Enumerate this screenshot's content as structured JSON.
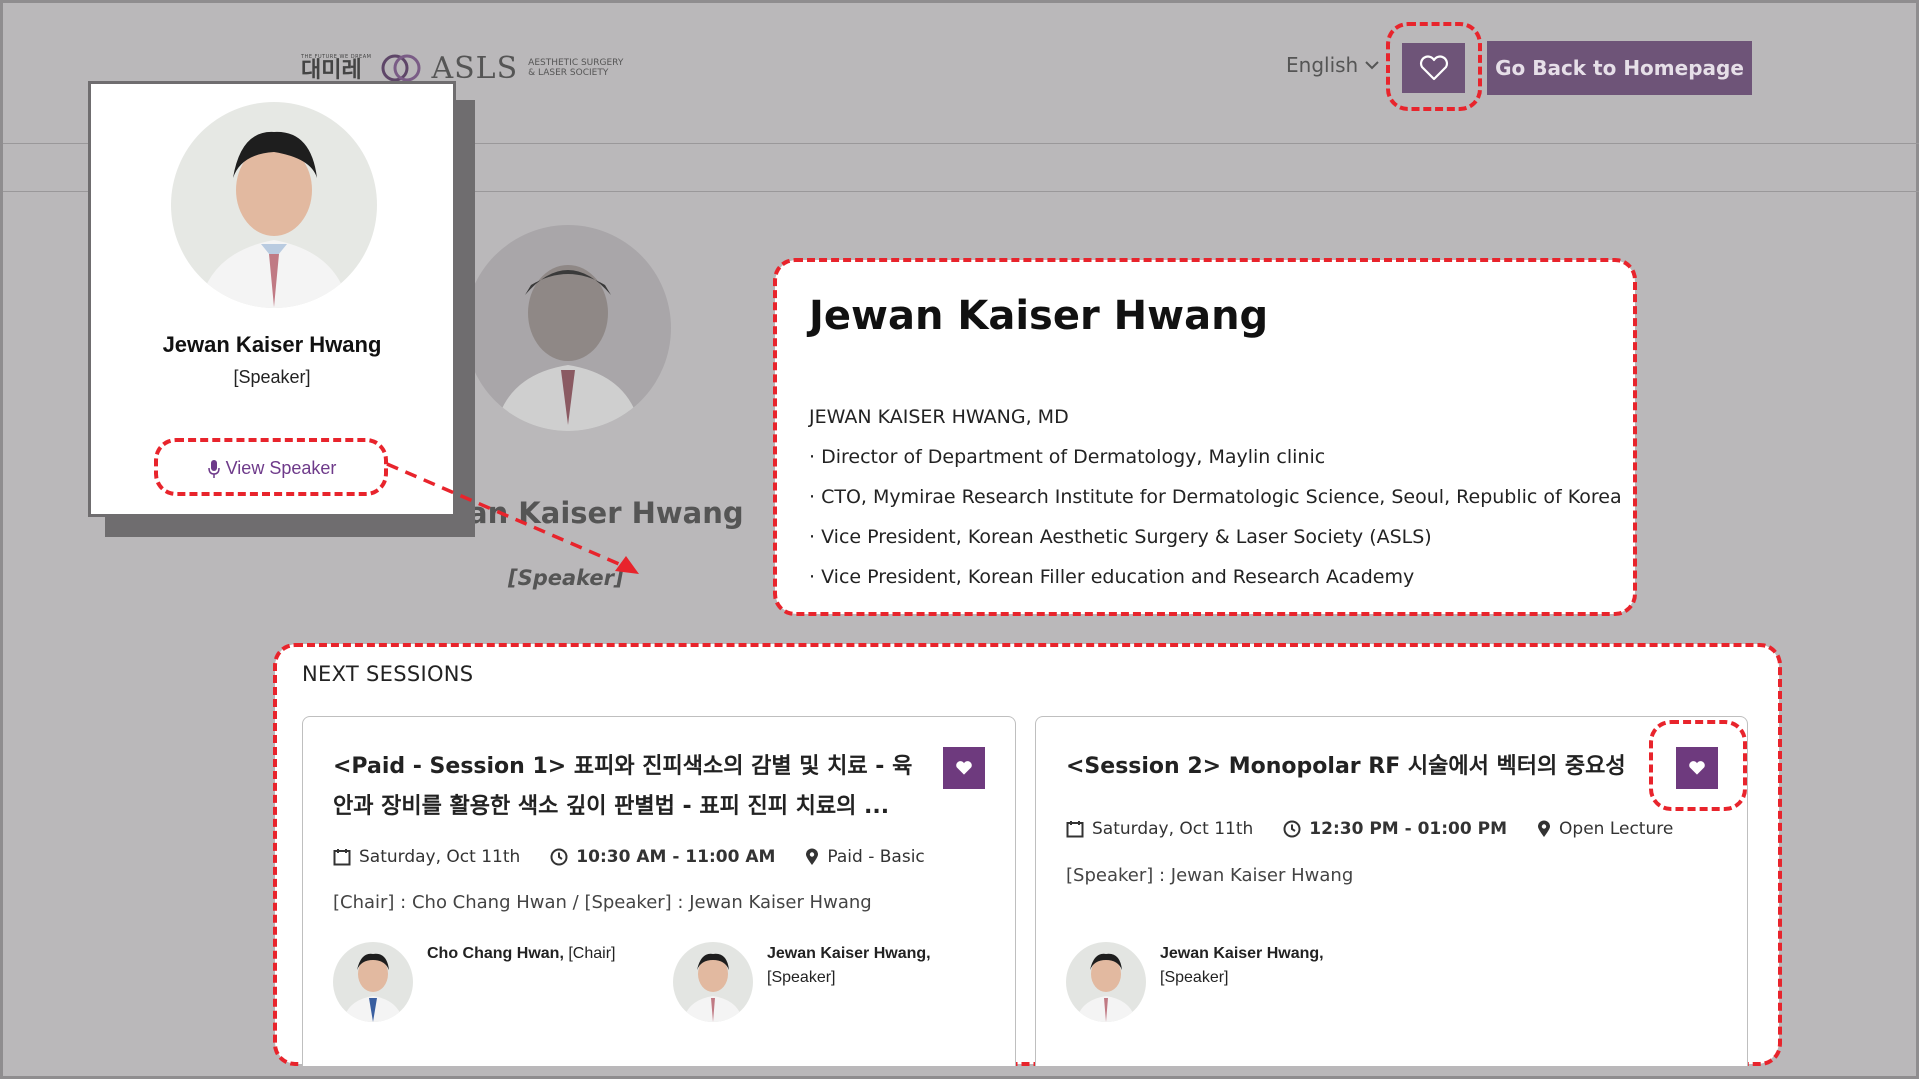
{
  "header": {
    "logo": {
      "tagline": "THE FUTURE WE DREAM",
      "korean": "대미레",
      "asls": "ASLS",
      "sub1": "AESTHETIC SURGERY",
      "sub2": "& LASER SOCIETY"
    },
    "language": "English",
    "home_button": "Go Back to Homepage"
  },
  "speaker": {
    "name": "Jewan Kaiser Hwang",
    "role": "[Speaker]",
    "bg_name": "an Kaiser Hwang",
    "view_label": "View Speaker"
  },
  "bio": {
    "title": "Jewan Kaiser Hwang",
    "subtitle": "JEWAN KAISER HWANG, MD",
    "items": [
      "· Director of Department of Dermatology, Maylin clinic",
      "· CTO, Mymirae Research Institute for Dermatologic Science, Seoul, Republic of Korea",
      "· Vice President, Korean Aesthetic Surgery & Laser Society (ASLS)",
      "· Vice President, Korean Filler education and Research Academy"
    ]
  },
  "sessions": {
    "heading": "NEXT SESSIONS",
    "items": [
      {
        "title_line1": "<Paid - Session 1> 표피와 진피색소의 감별 및 치료 - 육",
        "title_line2": "안과 장비를 활용한 색소 깊이 판별법 - 표피 진피 치료의 ...",
        "date": "Saturday, Oct 11th",
        "time": "10:30 AM - 11:00 AM",
        "location": "Paid - Basic",
        "people": "[Chair] : Cho Chang Hwan / [Speaker] : Jewan Kaiser Hwang",
        "persons": [
          {
            "name": "Cho Chang Hwan,",
            "role": "[Chair]"
          },
          {
            "name": "Jewan Kaiser Hwang,",
            "role": "[Speaker]"
          }
        ]
      },
      {
        "title_line1": "<Session 2> Monopolar RF 시술에서 벡터의 중요성",
        "date": "Saturday, Oct 11th",
        "time": "12:30 PM - 01:00 PM",
        "location": "Open Lecture",
        "people": "[Speaker] : Jewan Kaiser Hwang",
        "persons": [
          {
            "name": "Jewan Kaiser Hwang,",
            "role": "[Speaker]"
          }
        ]
      }
    ]
  },
  "colors": {
    "accent": "#6e5478",
    "highlight": "#e8242c",
    "overlay": "#bab8ba"
  }
}
